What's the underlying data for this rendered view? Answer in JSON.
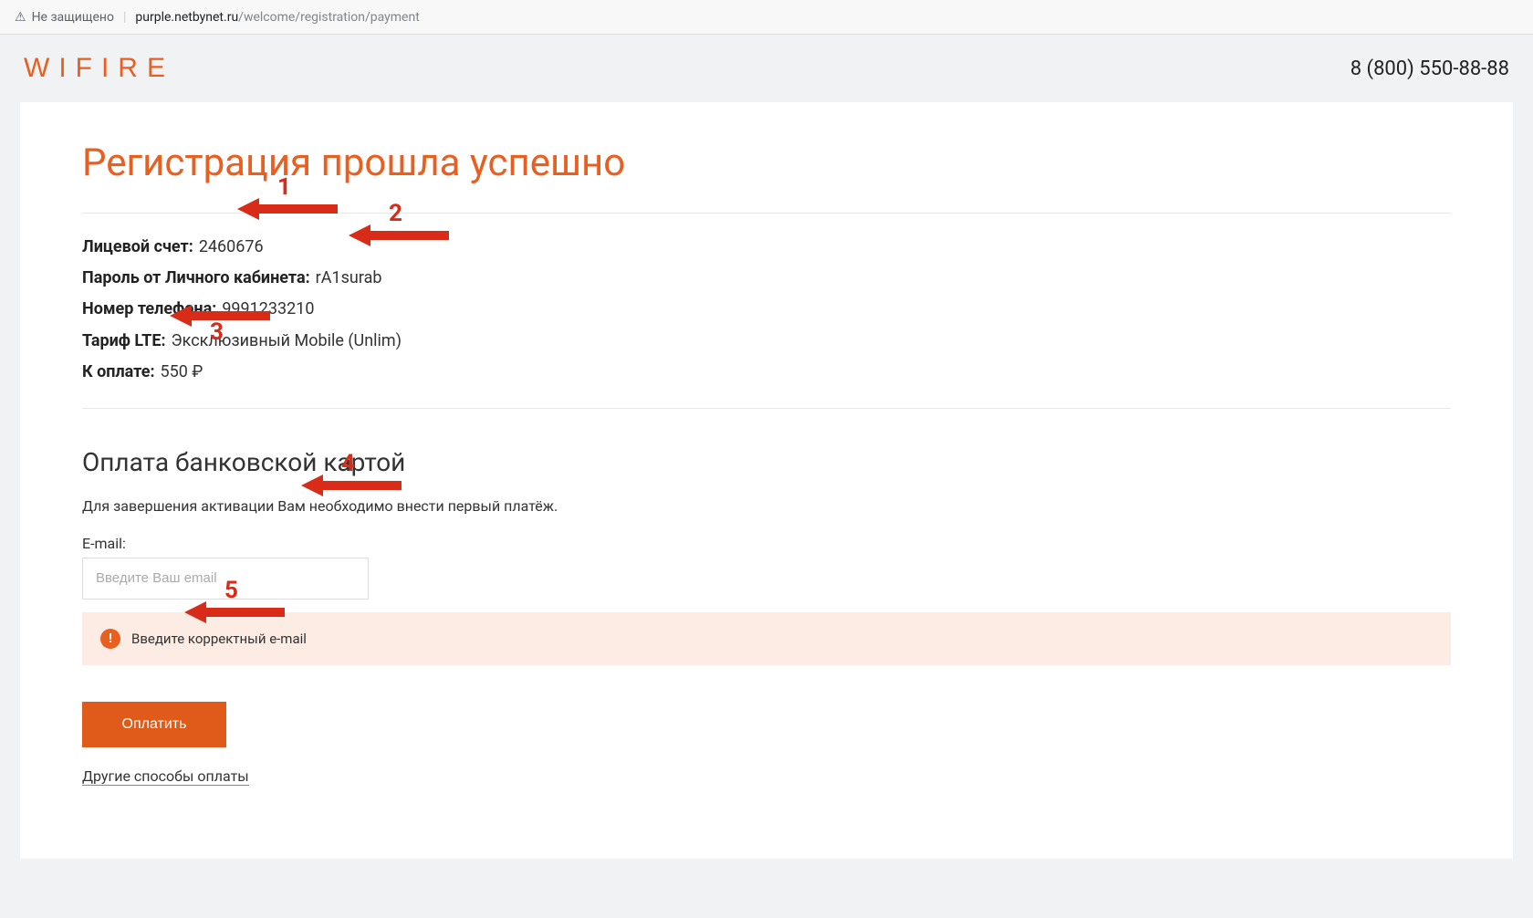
{
  "browser": {
    "security_label": "Не защищено",
    "url_domain": "purple.netbynet.ru",
    "url_path": "/welcome/registration/payment"
  },
  "header": {
    "logo_text": "WIFIRE",
    "phone": "8 (800) 550-88-88"
  },
  "main": {
    "title": "Регистрация прошла успешно",
    "account_label": "Лицевой счет:",
    "account_value": "2460676",
    "password_label": "Пароль от Личного кабинета:",
    "password_value": "rA1surab",
    "phone_label": "Номер телефона:",
    "phone_value": "9991233210",
    "tariff_label": "Тариф LTE:",
    "tariff_value": "Эксклюзивный Mobile (Unlim)",
    "amount_label": "К оплате:",
    "amount_value": "550 ₽"
  },
  "payment": {
    "subtitle": "Оплата банковской картой",
    "info": "Для завершения активации Вам необходимо внести первый платёж.",
    "email_label": "E-mail:",
    "email_placeholder": "Введите Ваш email",
    "error_text": "Введите корректный e-mail",
    "pay_button_label": "Оплатить",
    "other_methods_label": "Другие способы оплаты"
  },
  "annotations": {
    "n1": "1",
    "n2": "2",
    "n3": "3",
    "n4": "4",
    "n5": "5"
  },
  "colors": {
    "accent": "#e95f20",
    "annotation": "#d92c18",
    "error_bg": "#fdece4"
  }
}
